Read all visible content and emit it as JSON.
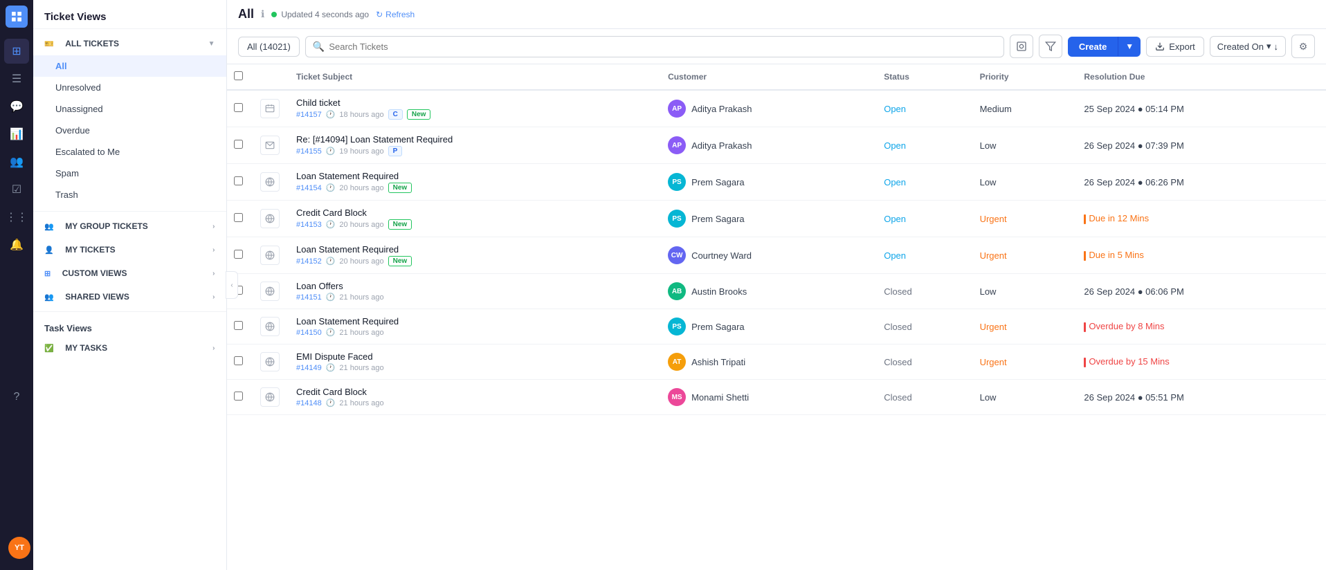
{
  "app": {
    "title": "Ticket Views"
  },
  "topbar": {
    "view_title": "All",
    "status_text": "Updated 4 seconds ago",
    "refresh_label": "Refresh"
  },
  "toolbar": {
    "all_count": "All (14021)",
    "search_placeholder": "Search Tickets",
    "create_label": "Create",
    "export_label": "Export",
    "sort_label": "Created On"
  },
  "table": {
    "columns": [
      "Ticket Subject",
      "Customer",
      "Status",
      "Priority",
      "Resolution Due"
    ],
    "rows": [
      {
        "id": "#14157",
        "time": "18 hours ago",
        "subject": "Child ticket",
        "icon_type": "ticket",
        "badges": [
          "C",
          "New"
        ],
        "customer_initials": "AP",
        "customer_name": "Aditya Prakash",
        "avatar_color": "#8b5cf6",
        "status": "Open",
        "priority": "Medium",
        "resolution_type": "normal",
        "resolution": "25 Sep 2024 ● 05:14 PM"
      },
      {
        "id": "#14155",
        "time": "19 hours ago",
        "subject": "Re: [#14094] Loan Statement Required",
        "icon_type": "email",
        "badges": [
          "P"
        ],
        "customer_initials": "AP",
        "customer_name": "Aditya Prakash",
        "avatar_color": "#8b5cf6",
        "status": "Open",
        "priority": "Low",
        "resolution_type": "normal",
        "resolution": "26 Sep 2024 ● 07:39 PM"
      },
      {
        "id": "#14154",
        "time": "20 hours ago",
        "subject": "Loan Statement Required",
        "icon_type": "globe",
        "badges": [
          "New"
        ],
        "customer_initials": "PS",
        "customer_name": "Prem Sagara",
        "avatar_color": "#06b6d4",
        "status": "Open",
        "priority": "Low",
        "resolution_type": "normal",
        "resolution": "26 Sep 2024 ● 06:26 PM"
      },
      {
        "id": "#14153",
        "time": "20 hours ago",
        "subject": "Credit Card Block",
        "icon_type": "globe",
        "badges": [
          "New"
        ],
        "customer_initials": "PS",
        "customer_name": "Prem Sagara",
        "avatar_color": "#06b6d4",
        "status": "Open",
        "priority": "Urgent",
        "resolution_type": "due",
        "resolution": "Due in 12 Mins"
      },
      {
        "id": "#14152",
        "time": "20 hours ago",
        "subject": "Loan Statement Required",
        "icon_type": "globe",
        "badges": [
          "New"
        ],
        "customer_initials": "CW",
        "customer_name": "Courtney Ward",
        "avatar_color": "#6366f1",
        "status": "Open",
        "priority": "Urgent",
        "resolution_type": "due",
        "resolution": "Due in 5 Mins"
      },
      {
        "id": "#14151",
        "time": "21 hours ago",
        "subject": "Loan Offers",
        "icon_type": "globe",
        "badges": [],
        "customer_initials": "AB",
        "customer_name": "Austin Brooks",
        "avatar_color": "#10b981",
        "status": "Closed",
        "priority": "Low",
        "resolution_type": "normal",
        "resolution": "26 Sep 2024 ● 06:06 PM"
      },
      {
        "id": "#14150",
        "time": "21 hours ago",
        "subject": "Loan Statement Required",
        "icon_type": "globe",
        "badges": [],
        "customer_initials": "PS",
        "customer_name": "Prem Sagara",
        "avatar_color": "#06b6d4",
        "status": "Closed",
        "priority": "Urgent",
        "resolution_type": "overdue",
        "resolution": "Overdue by 8 Mins"
      },
      {
        "id": "#14149",
        "time": "21 hours ago",
        "subject": "EMI Dispute Faced",
        "icon_type": "globe",
        "badges": [],
        "customer_initials": "AT",
        "customer_name": "Ashish Tripati",
        "avatar_color": "#f59e0b",
        "status": "Closed",
        "priority": "Urgent",
        "resolution_type": "overdue",
        "resolution": "Overdue by 15 Mins"
      },
      {
        "id": "#14148",
        "time": "21 hours ago",
        "subject": "Credit Card Block",
        "icon_type": "globe",
        "badges": [],
        "customer_initials": "MS",
        "customer_name": "Monami Shetti",
        "avatar_color": "#ec4899",
        "status": "Closed",
        "priority": "Low",
        "resolution_type": "normal",
        "resolution": "26 Sep 2024 ● 05:51 PM"
      }
    ]
  },
  "sidebar": {
    "title": "Ticket Views",
    "all_tickets_section": "ALL TICKETS",
    "items": [
      {
        "label": "All",
        "active": true
      },
      {
        "label": "Unresolved"
      },
      {
        "label": "Unassigned"
      },
      {
        "label": "Overdue"
      },
      {
        "label": "Escalated to Me"
      },
      {
        "label": "Spam"
      },
      {
        "label": "Trash"
      }
    ],
    "my_group_tickets": "MY GROUP TICKETS",
    "my_tickets": "MY TICKETS",
    "custom_views": "CUSTOM VIEWS",
    "shared_views": "SHARED VIEWS",
    "task_views": "Task Views",
    "my_tasks": "MY TASKS"
  }
}
